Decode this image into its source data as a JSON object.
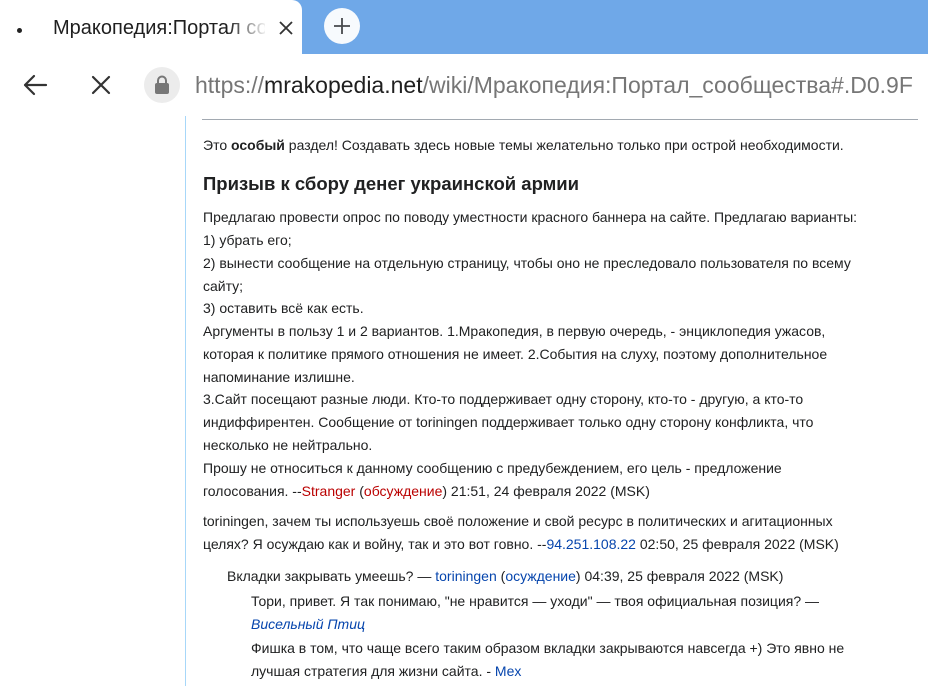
{
  "tab": {
    "title": "Мракопедия:Портал сообщества"
  },
  "toolbar": {
    "url_scheme": "https://",
    "url_host": "mrakopedia.net",
    "url_path": "/wiki/Мракопедия:Портал_сообщества#.D0.9F"
  },
  "article": {
    "intro_before": "Это ",
    "intro_bold": "особый",
    "intro_after": " раздел! Создавать здесь новые темы желательно только при острой необходимости.",
    "section_title": "Призыв к сбору денег украинской армии",
    "post1": {
      "lines": [
        "Предлагаю провести опрос по поводу уместности красного баннера на сайте. Предлагаю варианты:",
        "1) убрать его;",
        "2) вынести сообщение на отдельную страницу, чтобы оно не преследовало пользователя по всему",
        "сайту;",
        "3) оставить всё как есть.",
        "Аргументы в пользу 1 и 2 вариантов. 1.Мракопедия, в первую очередь, - энциклопедия ужасов,",
        "которая к политике прямого отношения не имеет. 2.События на слуху, поэтому дополнительное",
        "напоминание излишне.",
        "3.Сайт посещают разные люди. Кто-то поддерживает одну сторону, кто-то - другую, а кто-то",
        "индиффирентен. Сообщение от toriningen поддерживает только одну сторону конфликта, что",
        "несколько не нейтрально.",
        "Прошу не относиться к данному сообщению с предубеждением, его цель - предложение"
      ],
      "last_prefix": "голосования. --",
      "user": "Stranger",
      "talk": "обсуждение",
      "timestamp": " 21:51, 24 февраля 2022 (MSK)"
    },
    "post2": {
      "line1": "toriningen, зачем ты используешь своё положение и свой ресурс в политических и агитационных",
      "line2_prefix": "целях? Я осуждаю как и войну, так и это вот говно. --",
      "ip": "94.251.108.22",
      "timestamp": " 02:50, 25 февраля 2022 (MSK)"
    },
    "post3": {
      "prefix": "Вкладки закрывать умеешь? — ",
      "user": "toriningen",
      "talk": "осуждение",
      "timestamp": " 04:39, 25 февраля 2022 (MSK)"
    },
    "post4": {
      "line1": "Тори, привет. Я так понимаю, \"не нравится — уходи\" — твоя официальная позиция? —",
      "user": "Висельный Птиц"
    },
    "post5": {
      "line1": "Фишка в том, что чаще всего таким образом вкладки закрываются навсегда +) Это явно не",
      "line2_prefix": "лучшая стратегия для жизни сайта. - ",
      "user": "Mex"
    }
  }
}
